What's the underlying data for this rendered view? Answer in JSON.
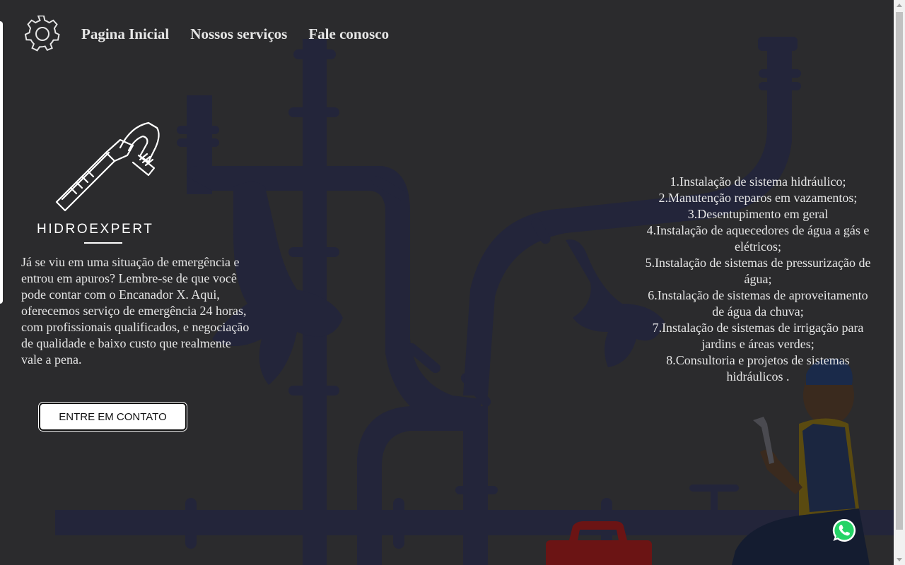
{
  "nav": {
    "items": [
      "Pagina Inicial",
      "Nossos serviços",
      "Fale conoscoo"
    ]
  },
  "brand": {
    "name": "HIDROEXPERT"
  },
  "intro": {
    "text": "Já se viu em uma situação de emergência e entrou em apuros? Lembre-se de que você pode contar com o Encanador X. Aqui, oferecemos serviço de emergência 24 horas, com profissionais qualificados, e negociação de qualidade e baixo custo que realmente vale a pena."
  },
  "cta": {
    "label": "ENTRE EM CONTATO"
  },
  "services": [
    "1.Instalação de sistema hidráulico;",
    "2.Manutenção reparos em vazamentos;",
    "3.Desentupimento em geral",
    "4.Instalação de aquecedores de água a gás e elétricos;",
    "5.Instalação de sistemas de pressurização de água;",
    "6.Instalação de sistemas de aproveitamento de água da chuva;",
    "7.Instalação de sistemas de irrigação para jardins e áreas verdes;",
    "8.Consultoria e projetos de sistemas hidráulicos ."
  ],
  "icons": {
    "settings": "gear-icon",
    "logo": "pipe-wrench-icon",
    "chat": "whatsapp-icon"
  },
  "colors": {
    "background": "#2b2b2d",
    "pipes": "#23253a",
    "text": "#e6e6e6",
    "button_bg": "#ffffff",
    "whatsapp": "#25d366"
  }
}
